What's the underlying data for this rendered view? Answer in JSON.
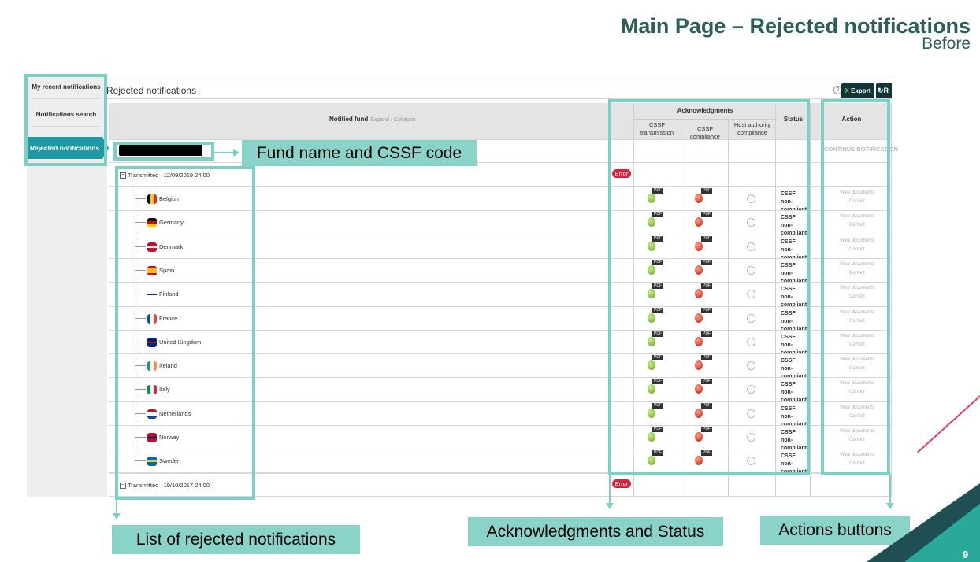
{
  "slide": {
    "title": "Main Page – Rejected notifications",
    "subtitle": "Before",
    "page_number": "9"
  },
  "sidebar": {
    "items": [
      {
        "label": "My recent notifications",
        "active": false
      },
      {
        "label": "Notifications search",
        "active": false
      },
      {
        "label": "Rejected notifications",
        "active": true
      }
    ]
  },
  "panel": {
    "title": "Rejected notifications",
    "help": "?",
    "export_label": "Export",
    "refresh_label": "R"
  },
  "table": {
    "headers": {
      "fund": "Notified fund",
      "expand_collapse": "Expand / Collapse",
      "acknowledgments": "Acknowledgments",
      "cssf_transmission": "CSSF transmission",
      "cssf_compliance": "CSSF compliance",
      "host_authority": "Host authority compliance",
      "status": "Status",
      "action": "Action"
    },
    "continue_label": "CONTINUE NOTIFICATION",
    "groups": [
      {
        "label": "Transmitted : 12/09/2019 24:00",
        "badge": "Error",
        "rows": [
          {
            "country": "Belgium",
            "flag": "belgium-flag-icon"
          },
          {
            "country": "Germany",
            "flag": "germany-flag-icon"
          },
          {
            "country": "Denmark",
            "flag": "denmark-flag-icon"
          },
          {
            "country": "Spain",
            "flag": "spain-flag-icon"
          },
          {
            "country": "Finland",
            "flag": "finland-flag-icon"
          },
          {
            "country": "France",
            "flag": "france-flag-icon"
          },
          {
            "country": "United Kingdom",
            "flag": "uk-flag-icon"
          },
          {
            "country": "Ireland",
            "flag": "ireland-flag-icon"
          },
          {
            "country": "Italy",
            "flag": "italy-flag-icon"
          },
          {
            "country": "Netherlands",
            "flag": "netherlands-flag-icon"
          },
          {
            "country": "Norway",
            "flag": "norway-flag-icon"
          },
          {
            "country": "Sweden",
            "flag": "sweden-flag-icon"
          }
        ]
      },
      {
        "label": "Transmitted : 19/10/2017 24:00",
        "badge": "Error",
        "rows": []
      }
    ],
    "row_values": {
      "pdf_label": "PDF",
      "status": "CSSF non-compliant",
      "action_view": "View documents",
      "action_correct": "Correct"
    }
  },
  "annotations": {
    "fund_name": "Fund name and CSSF code",
    "list": "List of rejected notifications",
    "ack_status": "Acknowledgments and Status",
    "actions": "Actions buttons"
  },
  "colors": {
    "teal_annotation": "#7ecfc6",
    "nav_active": "#1f9aa5",
    "error": "#d6223a",
    "title": "#2b5f58"
  }
}
